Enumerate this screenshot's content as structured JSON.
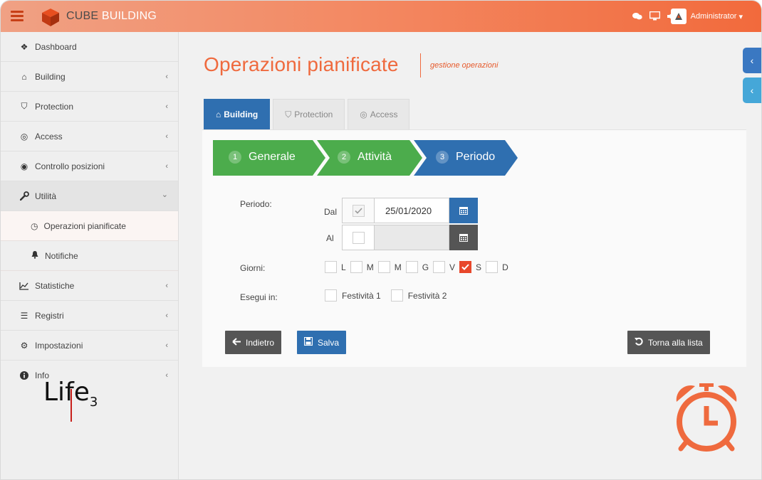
{
  "header": {
    "logo_part1": "CUBE",
    "logo_part2": " BUILDING",
    "user_name": "Administrator",
    "user_caret": "▾"
  },
  "sidebar": {
    "items": [
      {
        "label": "Dashboard",
        "icon": "dashboard-icon",
        "glyph": "❖"
      },
      {
        "label": "Building",
        "icon": "home-icon",
        "glyph": "⌂",
        "chevron": "‹"
      },
      {
        "label": "Protection",
        "icon": "shield-icon",
        "glyph": "⛉",
        "chevron": "‹"
      },
      {
        "label": "Access",
        "icon": "target-icon",
        "glyph": "◎",
        "chevron": "‹"
      },
      {
        "label": "Controllo posizioni",
        "icon": "eye-icon",
        "glyph": "◉",
        "chevron": "‹"
      },
      {
        "label": "Utilità",
        "icon": "wrench-icon",
        "glyph": "🔧",
        "chevron": "⌄"
      },
      {
        "label": "Operazioni pianificate",
        "icon": "clock-icon",
        "glyph": "◷"
      },
      {
        "label": "Notifiche",
        "icon": "bell-icon",
        "glyph": "🔔"
      },
      {
        "label": "Statistiche",
        "icon": "area-chart-icon",
        "glyph": "📈",
        "chevron": "‹"
      },
      {
        "label": "Registri",
        "icon": "list-icon",
        "glyph": "☰",
        "chevron": "‹"
      },
      {
        "label": "Impostazioni",
        "icon": "cogs-icon",
        "glyph": "⚙",
        "chevron": "‹"
      },
      {
        "label": "Info",
        "icon": "info-icon",
        "glyph": "ℹ",
        "chevron": "‹"
      }
    ],
    "footer_logo": {
      "prefix": "Li",
      "f": "f",
      "e": "e",
      "sub": "3"
    }
  },
  "page": {
    "title": "Operazioni pianificate",
    "subtitle": "gestione operazioni"
  },
  "tabs": [
    {
      "label": "Building",
      "glyph": "⌂"
    },
    {
      "label": "Protection",
      "glyph": "⛉"
    },
    {
      "label": "Access",
      "glyph": "◎"
    }
  ],
  "wizard": {
    "steps": [
      {
        "num": "1",
        "label": "Generale",
        "color": "#4cac4c"
      },
      {
        "num": "2",
        "label": "Attività",
        "color": "#4cac4c"
      },
      {
        "num": "3",
        "label": "Periodo",
        "color": "#2f6fb0"
      }
    ]
  },
  "form": {
    "periodo_label": "Periodo:",
    "dal_label": "Dal",
    "dal_value": "25/01/2020",
    "dal_checked": true,
    "al_label": "Al",
    "al_value": "",
    "al_checked": false,
    "giorni_label": "Giorni:",
    "days": [
      {
        "label": "L",
        "checked": false
      },
      {
        "label": "M",
        "checked": false
      },
      {
        "label": "M",
        "checked": false
      },
      {
        "label": "G",
        "checked": false
      },
      {
        "label": "V",
        "checked": false
      },
      {
        "label": "S",
        "checked": true
      },
      {
        "label": "D",
        "checked": false
      }
    ],
    "esegui_label": "Esegui in:",
    "holidays": [
      {
        "label": "Festività 1",
        "checked": false
      },
      {
        "label": "Festività 2",
        "checked": false
      }
    ]
  },
  "buttons": {
    "back": "Indietro",
    "save": "Salva",
    "back_to_list": "Torna alla lista"
  },
  "colors": {
    "accent": "#ef6a3e",
    "primary": "#2f6fb0",
    "success": "#4cac4c",
    "dark": "#555555",
    "danger_check": "#e8472b"
  }
}
